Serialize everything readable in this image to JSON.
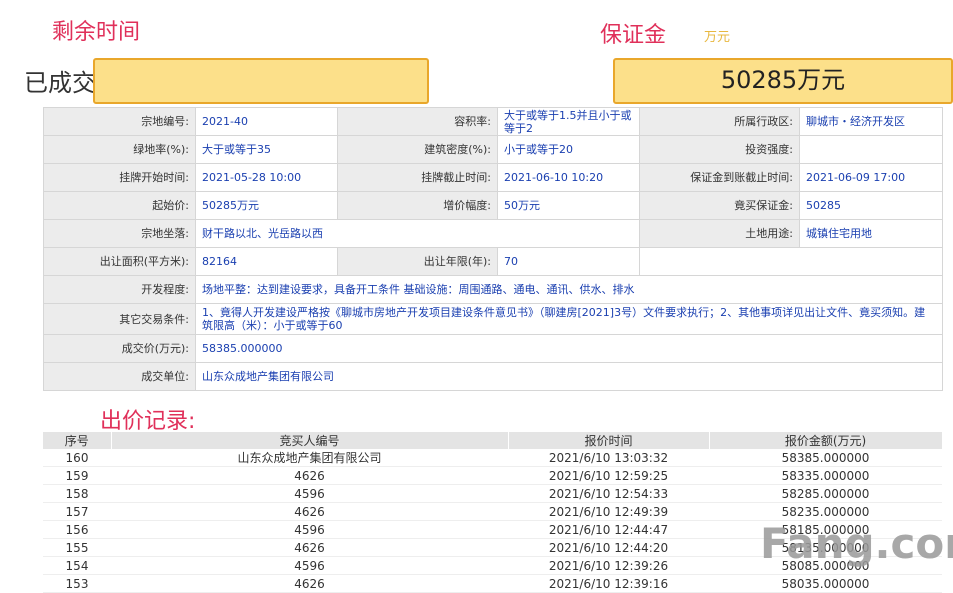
{
  "header": {
    "remaining_time_label": "剩余时间",
    "deposit_label": "保证金",
    "deposit_unit": "万元",
    "status_label": "已成交",
    "deal_amount": "50285万元"
  },
  "info_rows": [
    [
      {
        "k": "宗地编号:",
        "v": "2021-40"
      },
      {
        "k": "容积率:",
        "v": "大于或等于1.5并且小于或等于2"
      },
      {
        "k": "所属行政区:",
        "v": "聊城市・经济开发区"
      }
    ],
    [
      {
        "k": "绿地率(%):",
        "v": "大于或等于35"
      },
      {
        "k": "建筑密度(%):",
        "v": "小于或等于20"
      },
      {
        "k": "投资强度:",
        "v": ""
      }
    ],
    [
      {
        "k": "挂牌开始时间:",
        "v": "2021-05-28 10:00"
      },
      {
        "k": "挂牌截止时间:",
        "v": "2021-06-10 10:20"
      },
      {
        "k": "保证金到账截止时间:",
        "v": "2021-06-09 17:00"
      }
    ],
    [
      {
        "k": "起始价:",
        "v": "50285万元"
      },
      {
        "k": "增价幅度:",
        "v": "50万元"
      },
      {
        "k": "竟买保证金:",
        "v": "50285"
      }
    ]
  ],
  "info_location": {
    "k": "宗地坐落:",
    "v": "财干路以北、光岳路以西",
    "k2": "土地用途:",
    "v2": "城镇住宅用地"
  },
  "info_area": {
    "k": "出让面积(平方米):",
    "v": "82164",
    "k2": "出让年限(年):",
    "v2": "70"
  },
  "info_wide": [
    {
      "k": "开发程度:",
      "v": "场地平整：达到建设要求，具备开工条件 基础设施：周围通路、通电、通讯、供水、排水"
    },
    {
      "k": "其它交易条件:",
      "v": "1、竟得人开发建设严格按《聊城市房地产开发项目建设条件意见书》（聊建房[2021]3号）文件要求执行；2、其他事项详见出让文件、竟买须知。建筑限高（米）：小于或等于60"
    },
    {
      "k": "成交价(万元):",
      "v": "58385.000000"
    },
    {
      "k": "成交单位:",
      "v": "山东众成地产集团有限公司"
    }
  ],
  "bid_section_title": "出价记录:",
  "bid_headers": [
    "序号",
    "竞买人编号",
    "报价时间",
    "报价金额(万元)"
  ],
  "bids": [
    [
      "160",
      "山东众成地产集团有限公司",
      "2021/6/10 13:03:32",
      "58385.000000"
    ],
    [
      "159",
      "4626",
      "2021/6/10 12:59:25",
      "58335.000000"
    ],
    [
      "158",
      "4596",
      "2021/6/10 12:54:33",
      "58285.000000"
    ],
    [
      "157",
      "4626",
      "2021/6/10 12:49:39",
      "58235.000000"
    ],
    [
      "156",
      "4596",
      "2021/6/10 12:44:47",
      "58185.000000"
    ],
    [
      "155",
      "4626",
      "2021/6/10 12:44:20",
      "58135.000000"
    ],
    [
      "154",
      "4596",
      "2021/6/10 12:39:26",
      "58085.000000"
    ],
    [
      "153",
      "4626",
      "2021/6/10 12:39:16",
      "58035.000000"
    ]
  ],
  "watermark": "Fang.com"
}
